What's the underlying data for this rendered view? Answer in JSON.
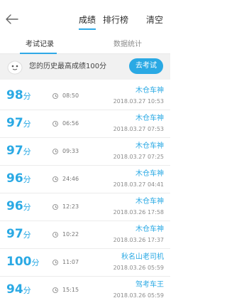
{
  "header": {
    "tabs": [
      {
        "label": "成绩",
        "active": true
      },
      {
        "label": "排行榜",
        "active": false
      }
    ],
    "clear_label": "清空",
    "accent_color": "#2aa9e4"
  },
  "subtabs": [
    {
      "label": "考试记录",
      "active": true
    },
    {
      "label": "数据统计",
      "active": false
    }
  ],
  "best": {
    "text": "您的历史最高成绩100分",
    "button_label": "去考试"
  },
  "records": [
    {
      "score": "98",
      "unit": "分",
      "time": "08:50",
      "name": "木仓车神",
      "date": "2018.03.27  10:53"
    },
    {
      "score": "97",
      "unit": "分",
      "time": "06:56",
      "name": "木仓车神",
      "date": "2018.03.27  07:53"
    },
    {
      "score": "97",
      "unit": "分",
      "time": "09:33",
      "name": "木仓车神",
      "date": "2018.03.27  07:25"
    },
    {
      "score": "96",
      "unit": "分",
      "time": "24:46",
      "name": "木仓车神",
      "date": "2018.03.27  04:41"
    },
    {
      "score": "96",
      "unit": "分",
      "time": "12:23",
      "name": "木仓车神",
      "date": "2018.03.26  17:58"
    },
    {
      "score": "97",
      "unit": "分",
      "time": "10:22",
      "name": "木仓车神",
      "date": "2018.03.26  17:37"
    },
    {
      "score": "100",
      "unit": "分",
      "time": "11:07",
      "name": "秋名山老司机",
      "date": "2018.03.26  05:59"
    },
    {
      "score": "94",
      "unit": "分",
      "time": "15:15",
      "name": "驾考车王",
      "date": "2018.03.26  05:59"
    }
  ]
}
